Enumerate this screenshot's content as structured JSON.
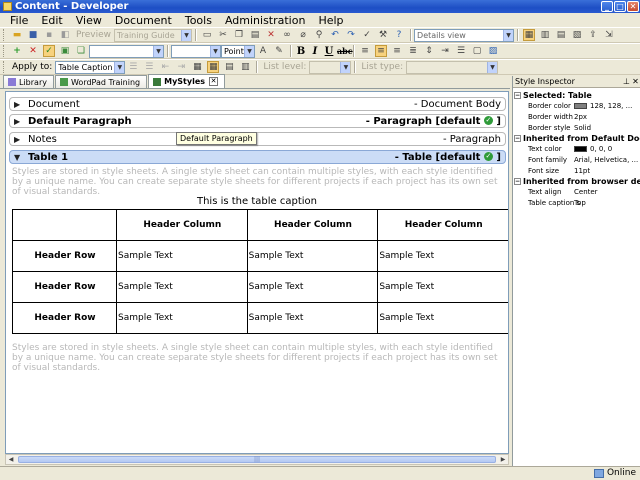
{
  "window": {
    "title": "Content - Developer"
  },
  "menu": [
    "File",
    "Edit",
    "View",
    "Document",
    "Tools",
    "Administration",
    "Help"
  ],
  "toolbar": {
    "preview_label": "Preview",
    "template_combo": "Training Guide",
    "view_combo": "Details view",
    "size_unit": "Points",
    "apply_to_label": "Apply to:",
    "apply_to_value": "Table Caption",
    "list_level_label": "List level:",
    "list_type_label": "List type:"
  },
  "tabs": [
    {
      "label": "Library",
      "active": false
    },
    {
      "label": "WordPad Training",
      "active": false
    },
    {
      "label": "MyStyles",
      "active": true
    }
  ],
  "styles": [
    {
      "name": "Document",
      "kind": "- Document Body",
      "bold": false,
      "selected": false,
      "expanded": false
    },
    {
      "name": "Default Paragraph",
      "kind": "- Paragraph [default",
      "bold": true,
      "default": true,
      "selected": false,
      "expanded": false
    },
    {
      "name": "Notes",
      "kind": "- Paragraph",
      "bold": false,
      "selected": false,
      "expanded": false
    },
    {
      "name": "Table 1",
      "kind": "- Table [default",
      "bold": true,
      "default": true,
      "selected": true,
      "expanded": true
    }
  ],
  "tooltip": "Default Paragraph",
  "body": {
    "intro_text": "Styles are stored in style sheets. A single style sheet can contain multiple styles, with each style identified by a unique name. You can create separate style sheets for different projects if each project has its own set of visual standards.",
    "outro_text": "Styles are stored in style sheets. A single style sheet can contain multiple styles, with each style identified by a unique name. You can create separate style sheets for different projects if each project has its own set of visual standards.",
    "table_caption": "This is the table caption",
    "table": {
      "headers": [
        "",
        "Header Column",
        "Header Column",
        "Header Column"
      ],
      "rows": [
        [
          "Header Row",
          "Sample Text",
          "Sample Text",
          "Sample Text"
        ],
        [
          "Header Row",
          "Sample Text",
          "Sample Text",
          "Sample Text"
        ],
        [
          "Header Row",
          "Sample Text",
          "Sample Text",
          "Sample Text"
        ]
      ]
    }
  },
  "inspector": {
    "title": "Style Inspector",
    "sections": [
      {
        "title": "Selected: Table",
        "props": [
          {
            "key": "Border color",
            "value": "128, 128, ...",
            "swatch": "#808080"
          },
          {
            "key": "Border width",
            "value": "2px"
          },
          {
            "key": "Border style",
            "value": "Solid"
          }
        ]
      },
      {
        "title": "Inherited from Default Documen",
        "props": [
          {
            "key": "Text color",
            "value": "0, 0, 0",
            "swatch": "#000000"
          },
          {
            "key": "Font family",
            "value": "Arial, Helvetica, ..."
          },
          {
            "key": "Font size",
            "value": "11pt"
          }
        ]
      },
      {
        "title": "Inherited from browser defaults",
        "props": [
          {
            "key": "Text align",
            "value": "Center"
          },
          {
            "key": "Table caption s",
            "value": "Top"
          }
        ]
      }
    ]
  },
  "status": {
    "connection": "Online"
  },
  "colors": {
    "title_bar": "#2457c8",
    "selection": "#cbdcf6",
    "default_badge": "#2f9b3a"
  }
}
